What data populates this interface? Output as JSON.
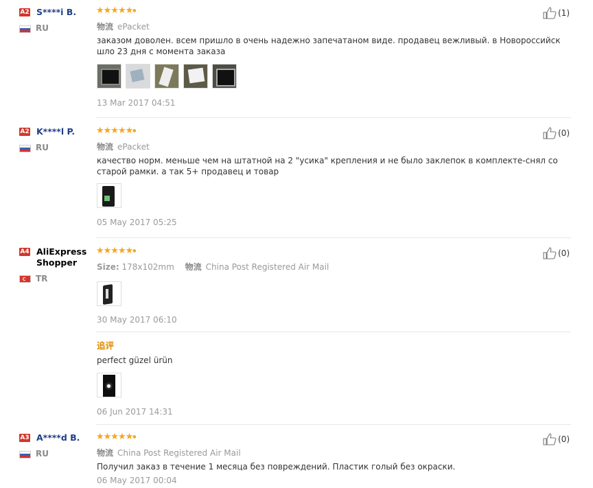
{
  "reviews": [
    {
      "badge": "A2",
      "user": "S****i B.",
      "country": "RU",
      "meta_key": "物流",
      "meta_val": "ePacket",
      "text": "заказом доволен. всем пришло в очень надежно запечатаном виде. продавец вежливый. в Новороссийск шло 23 дня с момента заказа",
      "date": "13 Mar 2017 04:51",
      "likes": "(1)"
    },
    {
      "badge": "A2",
      "user": "K****l P.",
      "country": "RU",
      "meta_key": "物流",
      "meta_val": "ePacket",
      "text": "качество норм. меньше чем на штатной на 2 \"усика\" крепления и не было заклепок в комплекте-снял со старой рамки. а так 5+ продавец и товар",
      "date": "05 May 2017 05:25",
      "likes": "(0)"
    },
    {
      "badge": "A4",
      "user": "AliExpress Shopper",
      "country": "TR",
      "size_key": "Size:",
      "size_val": "178x102mm",
      "meta_key": "物流",
      "meta_val": "China Post Registered Air Mail",
      "date": "30 May 2017 06:10",
      "followup_label": "追评",
      "followup_text": "perfect güzel ürün",
      "followup_date": "06 Jun 2017 14:31",
      "likes": "(0)"
    },
    {
      "badge": "A3",
      "user": "A****d B.",
      "country": "RU",
      "meta_key": "物流",
      "meta_val": "China Post Registered Air Mail",
      "text": "Получил заказ в течение 1 месяца без повреждений. Пластик голый без окраски.",
      "date": "06 May 2017 00:04",
      "likes": "(0)"
    }
  ],
  "stars": "★★★★★",
  "colors": {
    "star": "#f5a623",
    "badge": "#d0372c",
    "username": "#1f3f86",
    "followup": "#e08a00"
  }
}
